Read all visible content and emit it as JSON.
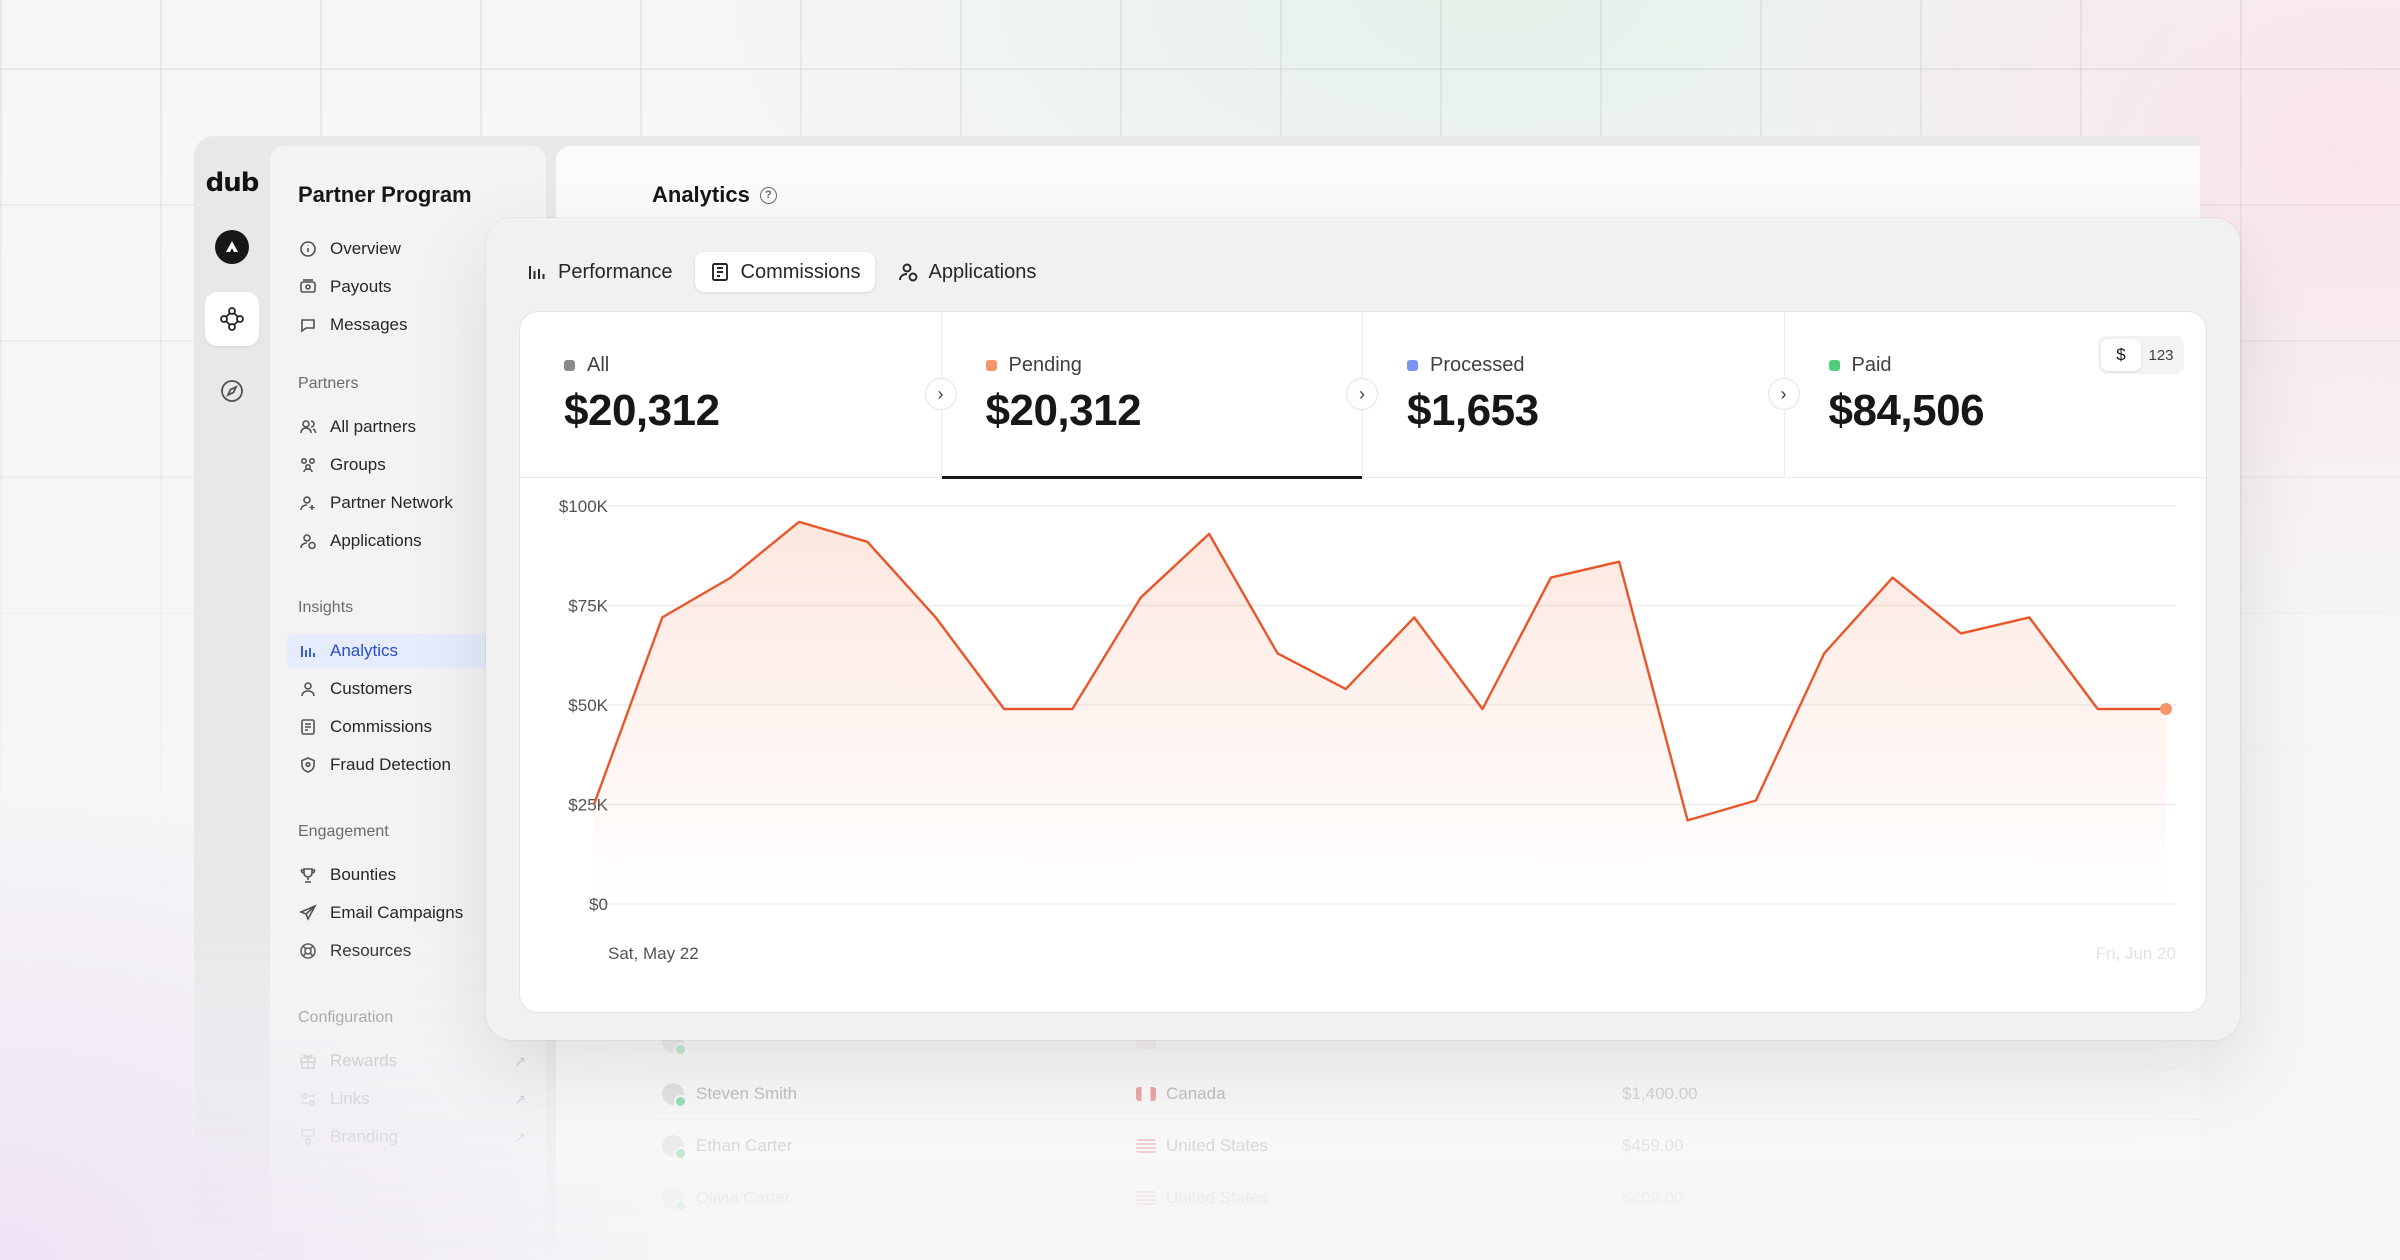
{
  "app": {
    "logo": "dub",
    "program_title": "Partner Program",
    "page_title": "Analytics",
    "help_glyph": "?"
  },
  "sidebar": {
    "top": [
      {
        "label": "Overview",
        "icon": "info-circle-icon"
      },
      {
        "label": "Payouts",
        "icon": "money-icon"
      },
      {
        "label": "Messages",
        "icon": "message-icon"
      }
    ],
    "sections": [
      {
        "heading": "Partners",
        "items": [
          {
            "label": "All partners",
            "icon": "users-icon"
          },
          {
            "label": "Groups",
            "icon": "users-group-icon"
          },
          {
            "label": "Partner Network",
            "icon": "user-plus-icon"
          },
          {
            "label": "Applications",
            "icon": "user-check-icon"
          }
        ]
      },
      {
        "heading": "Insights",
        "items": [
          {
            "label": "Analytics",
            "icon": "bar-chart-icon",
            "active": true
          },
          {
            "label": "Customers",
            "icon": "user-icon"
          },
          {
            "label": "Commissions",
            "icon": "receipt-icon"
          },
          {
            "label": "Fraud Detection",
            "icon": "shield-icon"
          }
        ]
      },
      {
        "heading": "Engagement",
        "items": [
          {
            "label": "Bounties",
            "icon": "trophy-icon"
          },
          {
            "label": "Email Campaigns",
            "icon": "paper-plane-icon"
          },
          {
            "label": "Resources",
            "icon": "lifebuoy-icon"
          }
        ]
      },
      {
        "heading": "Configuration",
        "items": [
          {
            "label": "Rewards",
            "icon": "gift-icon"
          },
          {
            "label": "Links",
            "icon": "link-icon"
          },
          {
            "label": "Branding",
            "icon": "paint-icon"
          }
        ]
      }
    ]
  },
  "tabs": [
    {
      "label": "Performance",
      "icon": "bar-chart-icon",
      "active": false
    },
    {
      "label": "Commissions",
      "icon": "receipt-icon",
      "active": true
    },
    {
      "label": "Applications",
      "icon": "user-check-icon",
      "active": false
    }
  ],
  "stats": [
    {
      "label": "All",
      "value": "$20,312",
      "color": "#8a8a8a"
    },
    {
      "label": "Pending",
      "value": "$20,312",
      "color": "#f5956b",
      "selected": true
    },
    {
      "label": "Processed",
      "value": "$1,653",
      "color": "#7b93f0"
    },
    {
      "label": "Paid",
      "value": "$84,506",
      "color": "#4fcf7d"
    }
  ],
  "toggle": {
    "currency": "$",
    "count": "123"
  },
  "chart_data": {
    "type": "area",
    "x_start_label": "Sat, May 22",
    "x_end_label": "Fri, Jun 20",
    "y_ticks": [
      "$0",
      "$25K",
      "$50K",
      "$75K",
      "$100K"
    ],
    "ylim": [
      0,
      100000
    ],
    "grid": true,
    "color": "#e8562a",
    "values": [
      25000,
      72000,
      82000,
      96000,
      91000,
      72000,
      49000,
      49000,
      77000,
      93000,
      63000,
      54000,
      72000,
      49000,
      82000,
      86000,
      21000,
      26000,
      63000,
      82000,
      68000,
      72000,
      49000,
      49000
    ]
  },
  "table": {
    "rows": [
      {
        "name": "Steven Smith",
        "country": "Canada",
        "amount": "$1,400.00",
        "flag": "ca"
      },
      {
        "name": "Ethan Carter",
        "country": "United States",
        "amount": "$459.00",
        "flag": "us"
      },
      {
        "name": "Olivia Carter",
        "country": "United States",
        "amount": "$409.00",
        "flag": "us"
      }
    ]
  }
}
